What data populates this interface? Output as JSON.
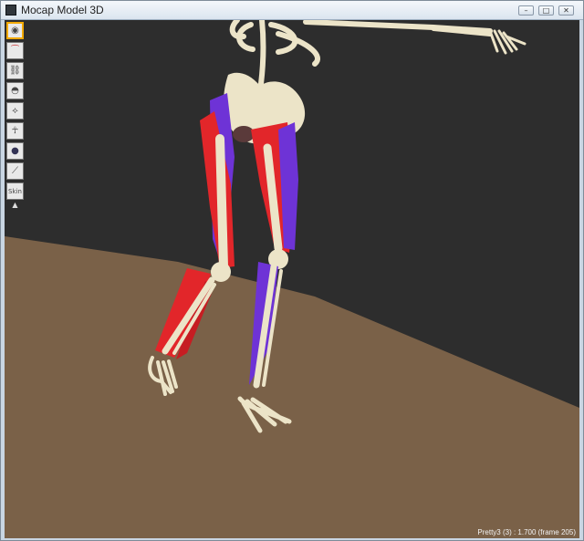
{
  "window": {
    "title": "Mocap Model 3D",
    "minimize_glyph": "–",
    "maximize_glyph": "□",
    "close_glyph": "✕"
  },
  "toolbar": {
    "tools": [
      {
        "name": "view-eye-icon",
        "active": true
      },
      {
        "name": "muscle-curve-icon",
        "active": false
      },
      {
        "name": "bone-chain-icon",
        "active": false
      },
      {
        "name": "sphere-cap-icon",
        "active": false
      },
      {
        "name": "joint-axis-icon",
        "active": false
      },
      {
        "name": "skeleton-figure-icon",
        "active": false
      },
      {
        "name": "ball-icon",
        "active": false
      },
      {
        "name": "bone-icon",
        "active": false
      },
      {
        "name": "skin-text-icon",
        "active": false,
        "label": "Skin"
      }
    ],
    "more_glyph": "▲"
  },
  "status": {
    "text": "Pretty3 (3) : 1.700 (frame 205)"
  },
  "colors": {
    "background": "#2d2d2d",
    "floor": "#7a6148",
    "bone": "#ece4c8",
    "muscle_red": "#e2262a",
    "muscle_blue": "#6e33d6",
    "active_tool": "#f2a900"
  }
}
